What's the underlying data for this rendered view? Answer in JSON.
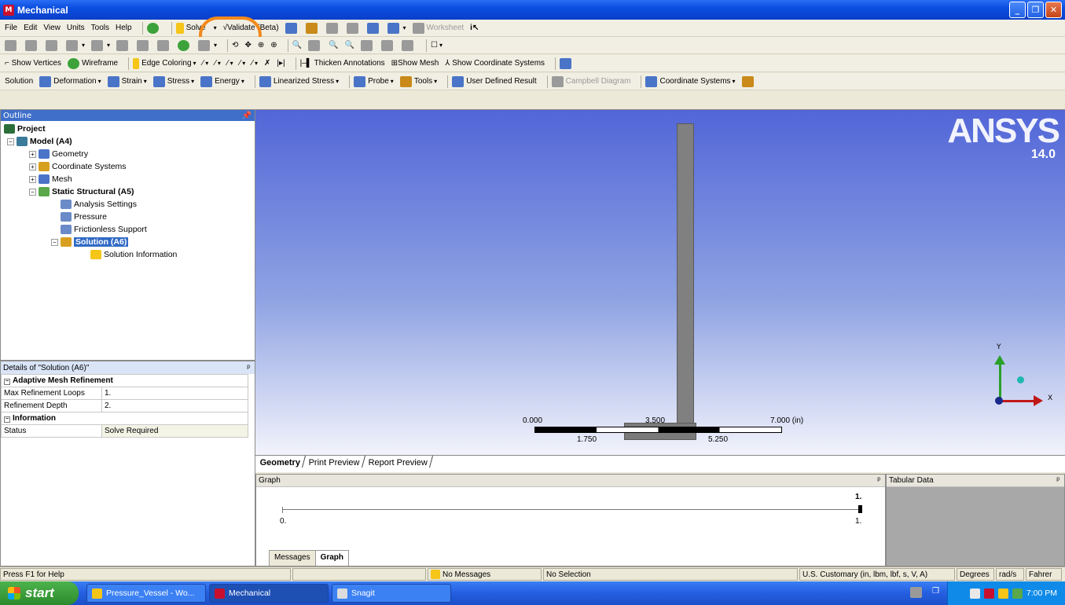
{
  "window": {
    "title": "Mechanical",
    "app_icon": "M"
  },
  "menu": [
    "File",
    "Edit",
    "View",
    "Units",
    "Tools",
    "Help"
  ],
  "toolbar1": {
    "solve": "Solve",
    "validate": "Validate (Beta)",
    "worksheet": "Worksheet"
  },
  "toolbar3": {
    "show_vertices": "Show Vertices",
    "wireframe": "Wireframe",
    "edge_coloring": "Edge Coloring",
    "thicken": "Thicken Annotations",
    "show_mesh": "Show Mesh",
    "show_coords": "Show Coordinate Systems"
  },
  "toolbar4": {
    "solution": "Solution",
    "deformation": "Deformation",
    "strain": "Strain",
    "stress": "Stress",
    "energy": "Energy",
    "linearized": "Linearized Stress",
    "probe": "Probe",
    "tools": "Tools",
    "user_defined": "User Defined Result",
    "campbell": "Campbell Diagram",
    "coord_systems": "Coordinate Systems"
  },
  "outline": {
    "title": "Outline",
    "pin": "ᵖ",
    "items": [
      {
        "label": "Project"
      },
      {
        "label": "Model (A4)"
      },
      {
        "label": "Geometry"
      },
      {
        "label": "Coordinate Systems"
      },
      {
        "label": "Mesh"
      },
      {
        "label": "Static Structural (A5)"
      },
      {
        "label": "Analysis Settings"
      },
      {
        "label": "Pressure"
      },
      {
        "label": "Frictionless Support"
      },
      {
        "label": "Solution (A6)"
      },
      {
        "label": "Solution Information"
      }
    ]
  },
  "details": {
    "title": "Details of \"Solution (A6)\"",
    "group1": "Adaptive Mesh Refinement",
    "rows1": [
      {
        "key": "Max Refinement Loops",
        "value": "1."
      },
      {
        "key": "Refinement Depth",
        "value": "2."
      }
    ],
    "group2": "Information",
    "rows2": [
      {
        "key": "Status",
        "value": "Solve Required"
      }
    ]
  },
  "viewport": {
    "logo": "ANSYS",
    "version": "14.0",
    "scale": {
      "l0": "0.000",
      "l1": "1.750",
      "l2": "3.500",
      "l3": "5.250",
      "l4": "7.000 (in)"
    },
    "axis_x": "X",
    "axis_y": "Y"
  },
  "view_tabs": [
    "Geometry",
    "Print Preview",
    "Report Preview"
  ],
  "graph": {
    "title": "Graph",
    "top_right": "1.",
    "left": "0.",
    "right": "1.",
    "tabs": [
      "Messages",
      "Graph"
    ]
  },
  "tabular": {
    "title": "Tabular Data"
  },
  "status": {
    "help": "Press F1 for Help",
    "messages": "No Messages",
    "selection": "No Selection",
    "units": "U.S. Customary (in, lbm, lbf, s, V, A)",
    "angle": "Degrees",
    "rate": "rad/s",
    "temp": "Fahrer"
  },
  "taskbar": {
    "start": "start",
    "tasks": [
      "Pressure_Vessel - Wo...",
      "Mechanical",
      "Snagit"
    ],
    "time": "7:00 PM"
  },
  "colors": {
    "highlight": "#f28a1e",
    "title_bar": "#0a4ee0"
  }
}
